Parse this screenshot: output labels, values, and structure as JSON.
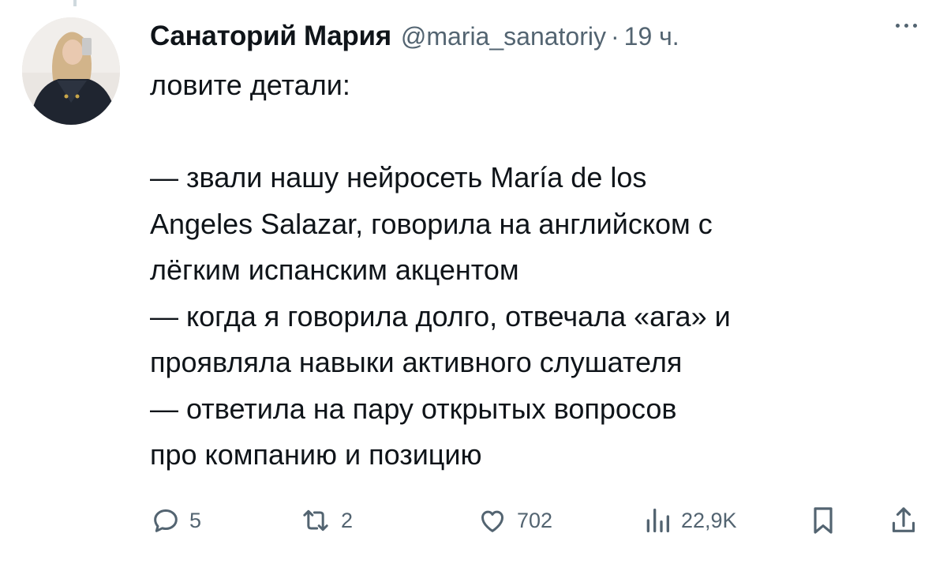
{
  "tweet": {
    "author_name": "Санаторий Мария",
    "handle": "@maria_sanatoriy",
    "separator": "·",
    "time": "19 ч.",
    "lines": [
      "ловите детали:",
      "",
      "— звали нашу нейросеть María de los",
      "Angeles Salazar, говорила на английском с",
      "лёгким испанским акцентом",
      "— когда я говорила долго, отвечала «ага» и",
      "проявляла навыки активного слушателя",
      "— ответила на пару открытых вопросов",
      "про компанию и позицию"
    ]
  },
  "actions": {
    "replies": "5",
    "reposts": "2",
    "likes": "702",
    "views": "22,9K"
  },
  "icons": [
    "more-icon",
    "reply-icon",
    "repost-icon",
    "like-icon",
    "views-icon",
    "bookmark-icon",
    "share-icon"
  ],
  "colors": {
    "text": "#0f1419",
    "secondary": "#536471",
    "background": "#ffffff"
  }
}
